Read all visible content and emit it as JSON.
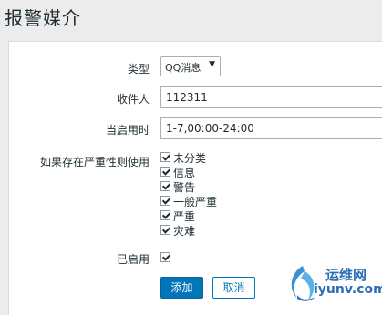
{
  "page": {
    "title": "报警媒介"
  },
  "form": {
    "type_label": "类型",
    "type_value": "QQ消息",
    "recipient_label": "收件人",
    "recipient_value": "112311",
    "when_active_label": "当启用时",
    "when_active_value": "1-7,00:00-24:00",
    "severity_label": "如果存在严重性则使用",
    "severities": [
      {
        "label": "未分类",
        "checked": true
      },
      {
        "label": "信息",
        "checked": true
      },
      {
        "label": "警告",
        "checked": true
      },
      {
        "label": "一般严重",
        "checked": true
      },
      {
        "label": "严重",
        "checked": true
      },
      {
        "label": "灾难",
        "checked": true
      }
    ],
    "enabled_label": "已启用",
    "enabled_checked": true
  },
  "buttons": {
    "add": "添加",
    "cancel": "取消"
  },
  "watermark": {
    "line1": "运维网",
    "line2": "iyunv.com"
  }
}
